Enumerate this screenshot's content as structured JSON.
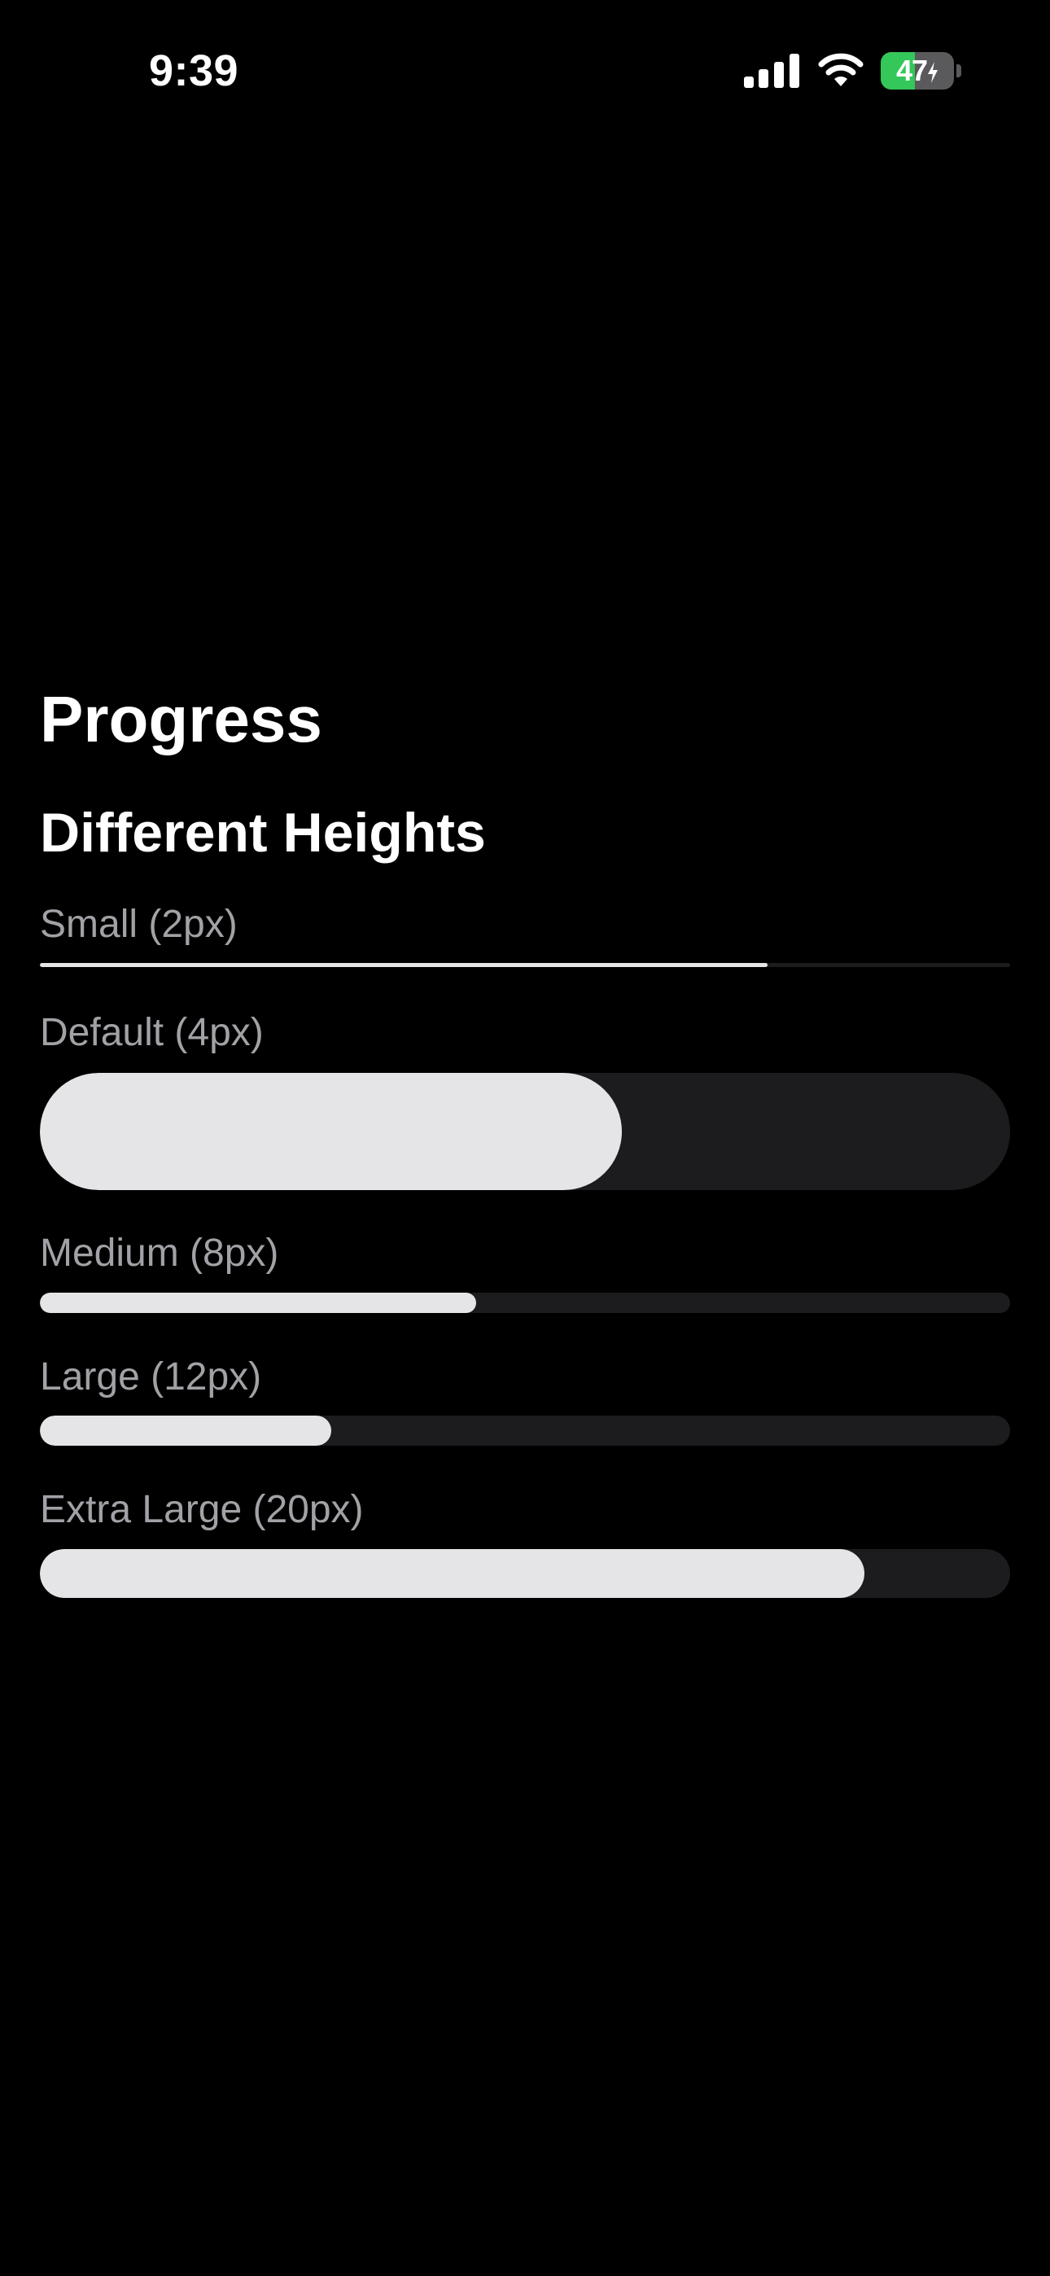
{
  "status_bar": {
    "time": "9:39",
    "battery_percent": "47",
    "battery_level": 0.47,
    "battery_color": "#34c759",
    "icons": [
      "signal-icon",
      "wifi-icon",
      "battery-icon",
      "charging-bolt-icon"
    ]
  },
  "page": {
    "title": "Progress",
    "section_title": "Different Heights"
  },
  "progress_bars": [
    {
      "label": "Small (2px)",
      "value": 75
    },
    {
      "label": "Default (4px)",
      "value": 60
    },
    {
      "label": "Medium (8px)",
      "value": 45
    },
    {
      "label": "Large (12px)",
      "value": 30
    },
    {
      "label": "Extra Large (20px)",
      "value": 85
    }
  ],
  "colors": {
    "background": "#000000",
    "track": "#1c1c1e",
    "fill": "#e5e5e7",
    "label": "#a1a1a6"
  }
}
